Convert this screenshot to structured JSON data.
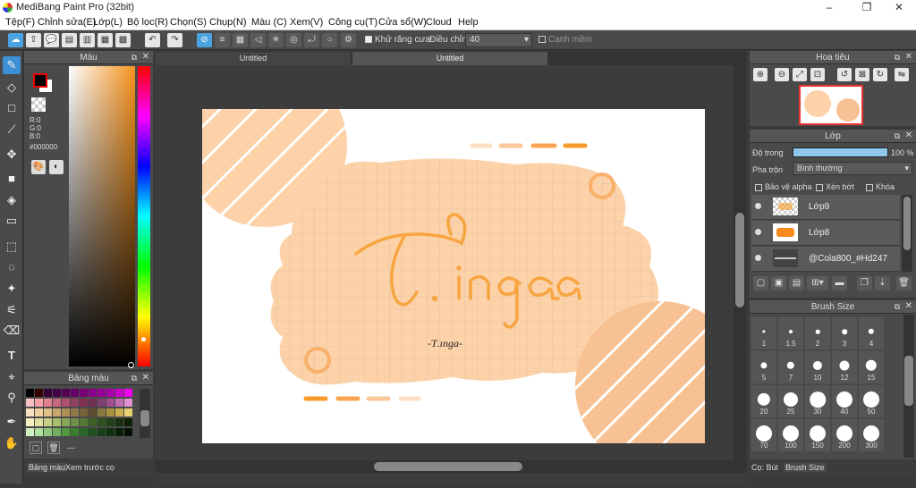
{
  "app": {
    "title": "MediBang Paint Pro (32bit)"
  },
  "menu": [
    "Tệp(F)",
    "Chỉnh sửa(E)",
    "Lớp(L)",
    "Bộ lọc(R)",
    "Chọn(S)",
    "Chụp(N)",
    "Màu (C)",
    "Xem(V)",
    "Công cụ(T)",
    "Cửa sổ(W)",
    "Cloud",
    "Help"
  ],
  "toolbar": {
    "antialias_label": "Khử răng cưa",
    "adjust_label": "Điều chỉnh",
    "adjust_value": "40",
    "edge_label": "Cạnh mềm"
  },
  "color_panel": {
    "title": "Màu",
    "r": "R:0",
    "g": "G:0",
    "b": "B:0",
    "hex": "#000000"
  },
  "swatch_panel": {
    "title": "Bảng màu",
    "footer": "---"
  },
  "left_tabs": [
    "Bảng màu",
    "Xem trước cọ"
  ],
  "doc_tabs": [
    "Untitled",
    "Untitled"
  ],
  "canvas": {
    "signature": "-Ƭ.ınga-",
    "colors": {
      "peach": "#fdd2a8",
      "orange": "#f7a540",
      "light": "#f8c193"
    }
  },
  "navigator": {
    "title": "Hoa tiêu"
  },
  "layers": {
    "title": "Lớp",
    "opacity_label": "Độ trong",
    "opacity_value": "100 %",
    "opacity": 1.0,
    "blend_label": "Pha trộn",
    "blend_value": "Bình thường",
    "protect_alpha": "Bảo vệ alpha",
    "clipping": "Xén bớt",
    "lock": "Khóa",
    "items": [
      {
        "name": "Lớp9"
      },
      {
        "name": "Lớp8"
      },
      {
        "name": "@Cola800_#Hd247"
      }
    ]
  },
  "brush_size": {
    "title": "Brush Size",
    "sizes": [
      "1",
      "1.5",
      "2",
      "3",
      "4",
      "5",
      "7",
      "10",
      "12",
      "15",
      "20",
      "25",
      "30",
      "40",
      "50",
      "70",
      "100",
      "150",
      "200",
      "300"
    ]
  },
  "right_tabs": [
    "Cọ: Bút",
    "Brush Size"
  ]
}
